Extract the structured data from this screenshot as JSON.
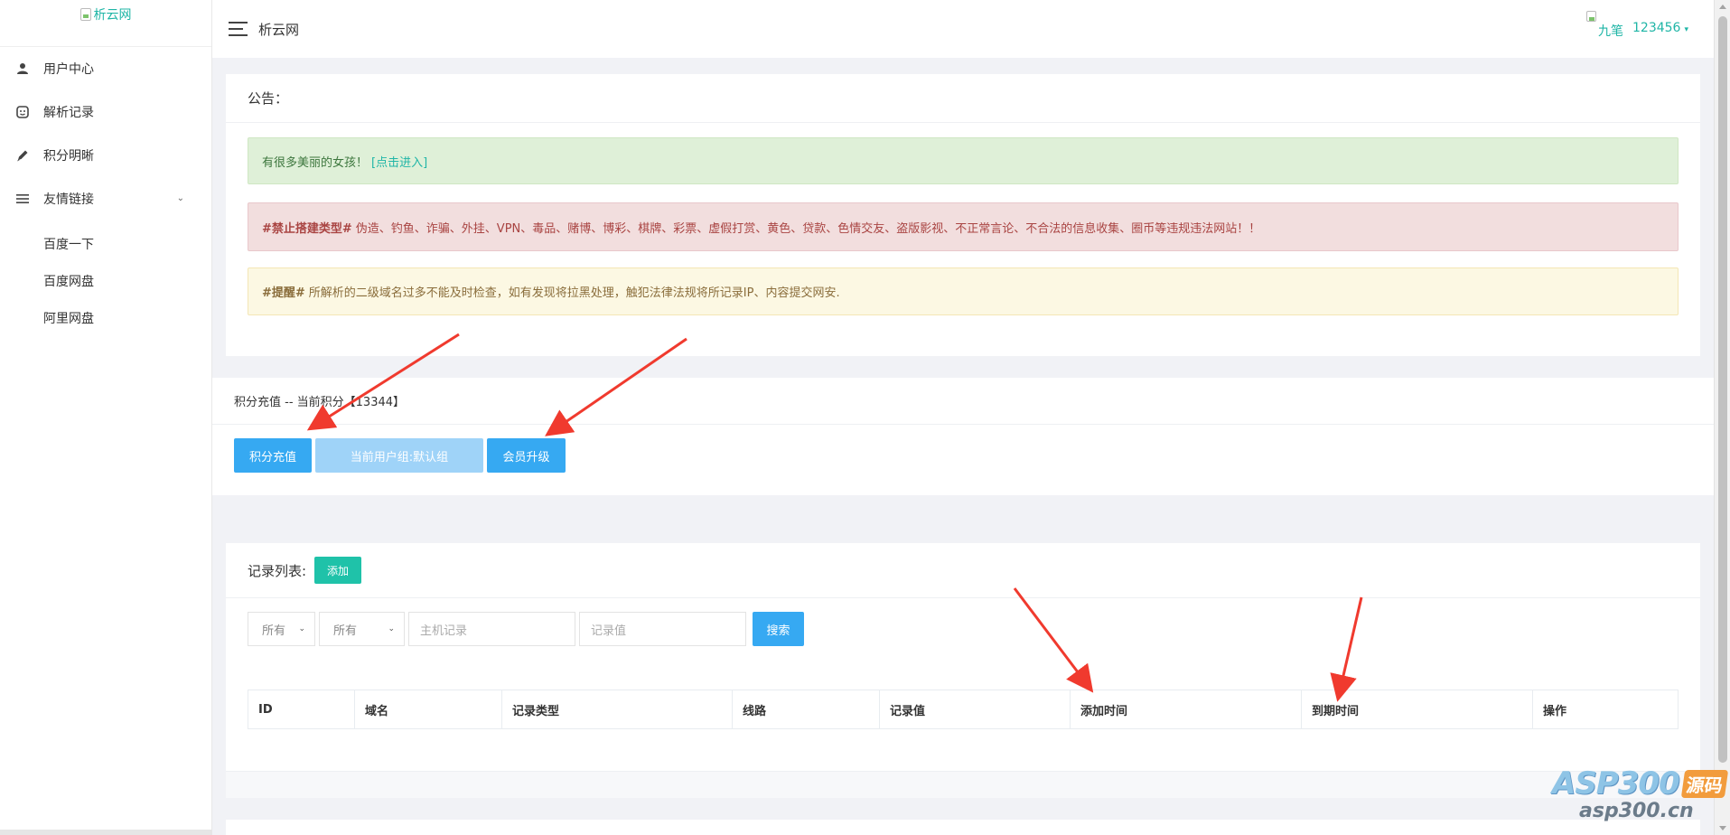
{
  "sidebar": {
    "logo_alt": "析云网",
    "items": [
      {
        "label": "用户中心",
        "icon": "user-icon"
      },
      {
        "label": "解析记录",
        "icon": "record-icon"
      },
      {
        "label": "积分明晰",
        "icon": "pen-icon"
      },
      {
        "label": "友情链接",
        "icon": "menu-icon"
      }
    ],
    "links": [
      "百度一下",
      "百度网盘",
      "阿里网盘"
    ]
  },
  "header": {
    "title": "析云网",
    "user_name": "九笔",
    "user_id": "123456"
  },
  "notice": {
    "title": "公告：",
    "success_text": "有很多美丽的女孩！",
    "success_link": "[点击进入]",
    "danger_tag": "#禁止搭建类型#",
    "danger_text": "伪造、钓鱼、诈骗、外挂、VPN、毒品、赌博、博彩、棋牌、彩票、虚假打赏、黄色、贷款、色情交友、盗版影视、不正常言论、不合法的信息收集、圈币等违规违法网站！！",
    "warning_tag": "#提醒#",
    "warning_text": "所解析的二级域名过多不能及时检查，如有发现将拉黑处理，触犯法律法规将所记录IP、内容提交网安."
  },
  "points": {
    "title": "积分充值 -- 当前积分【13344】",
    "recharge_button": "积分充值",
    "group_button": "当前用户组:默认组",
    "upgrade_button": "会员升级"
  },
  "records": {
    "title": "记录列表:",
    "add_button": "添加",
    "filter1": "所有",
    "filter2": "所有",
    "host_placeholder": "主机记录",
    "value_placeholder": "记录值",
    "search_button": "搜索",
    "columns": [
      "ID",
      "域名",
      "记录类型",
      "线路",
      "记录值",
      "添加时间",
      "到期时间",
      "操作"
    ]
  },
  "watermark": {
    "brand": "ASP300",
    "tag": "源码",
    "url": "asp300.cn"
  },
  "colors": {
    "accent": "#1fb5a6",
    "primary": "#36a9f2",
    "arrow": "#f03a2e"
  }
}
